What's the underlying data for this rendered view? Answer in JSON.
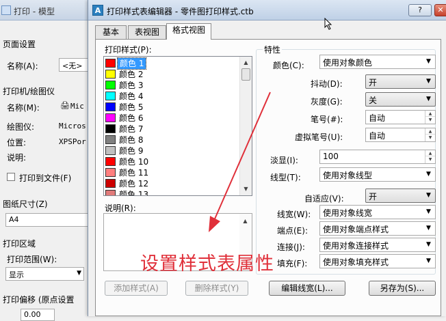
{
  "background_dialog": {
    "title": "打印 - 模型",
    "page_setup": "页面设置",
    "name_label": "名称(A):",
    "name_value": "<无>",
    "printer_group": "打印机/绘图仪",
    "printer_name_label": "名称(M):",
    "printer_name_value": "Mic",
    "plotter_label": "绘图仪:",
    "plotter_value": "Micros",
    "location_label": "位置:",
    "location_value": "XPSPor",
    "description_label": "说明:",
    "print_to_file_label": "打印到文件(F)",
    "paper_size_label": "图纸尺寸(Z)",
    "paper_size_value": "A4",
    "print_area_label": "打印区域",
    "print_range_label": "打印范围(W):",
    "print_range_value": "显示",
    "print_offset_label": "打印偏移 (原点设置",
    "offset_value": "0.00"
  },
  "window": {
    "title": "打印样式表编辑器 - 零件图打印样式.ctb",
    "help_label": "?",
    "close_label": "✕"
  },
  "tabs": [
    {
      "label": "基本",
      "active": false
    },
    {
      "label": "表视图",
      "active": false
    },
    {
      "label": "格式视图",
      "active": true
    }
  ],
  "style_list": {
    "label": "打印样式(P):",
    "items": [
      {
        "label": "颜色 1",
        "color": "#ff0000",
        "selected": true
      },
      {
        "label": "颜色 2",
        "color": "#ffff00",
        "selected": false
      },
      {
        "label": "颜色 3",
        "color": "#00ff00",
        "selected": false
      },
      {
        "label": "颜色 4",
        "color": "#00ffff",
        "selected": false
      },
      {
        "label": "颜色 5",
        "color": "#0000ff",
        "selected": false
      },
      {
        "label": "颜色 6",
        "color": "#ff00ff",
        "selected": false
      },
      {
        "label": "颜色 7",
        "color": "#000000",
        "selected": false
      },
      {
        "label": "颜色 8",
        "color": "#808080",
        "selected": false
      },
      {
        "label": "颜色 9",
        "color": "#c0c0c0",
        "selected": false
      },
      {
        "label": "颜色 10",
        "color": "#ff0000",
        "selected": false
      },
      {
        "label": "颜色 11",
        "color": "#ff7f7f",
        "selected": false
      },
      {
        "label": "颜色 12",
        "color": "#cc0000",
        "selected": false
      },
      {
        "label": "颜色 13",
        "color": "#e07a7a",
        "selected": false
      }
    ]
  },
  "description": {
    "label": "说明(R):"
  },
  "buttons": {
    "add_style": "添加样式(A)",
    "delete_style": "删除样式(Y)",
    "edit_lineweight": "编辑线宽(L)...",
    "save_as": "另存为(S)..."
  },
  "properties": {
    "group_label": "特性",
    "color_label": "颜色(C):",
    "color_value": "使用对象颜色",
    "dither_label": "抖动(D):",
    "dither_value": "开",
    "grayscale_label": "灰度(G):",
    "grayscale_value": "关",
    "pen_label": "笔号(#):",
    "pen_value": "自动",
    "virtual_pen_label": "虚拟笔号(U):",
    "virtual_pen_value": "自动",
    "screening_label": "淡显(I):",
    "screening_value": "100",
    "linetype_label": "线型(T):",
    "linetype_value": "使用对象线型",
    "adaptive_label": "自适应(V):",
    "adaptive_value": "开",
    "lineweight_label": "线宽(W):",
    "lineweight_value": "使用对象线宽",
    "end_style_label": "端点(E):",
    "end_style_value": "使用对象端点样式",
    "join_style_label": "连接(J):",
    "join_style_value": "使用对象连接样式",
    "fill_style_label": "填充(F):",
    "fill_style_value": "使用对象填充样式"
  },
  "annotation": {
    "text": "设置样式表属性",
    "color": "#e0303a"
  }
}
